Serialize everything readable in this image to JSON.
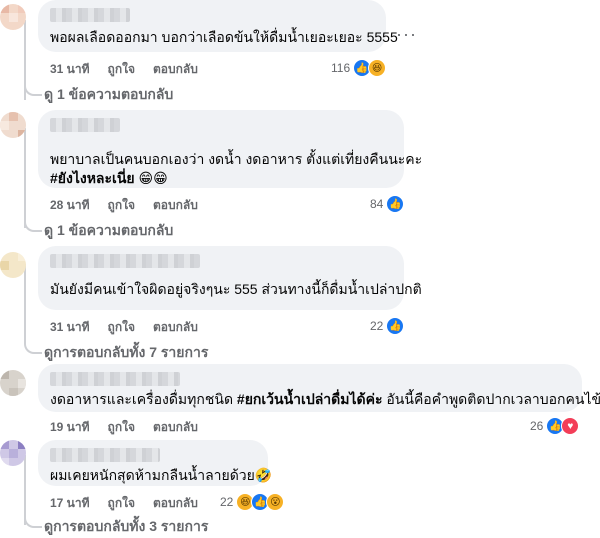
{
  "comments": [
    {
      "text": "พอผลเลือดออกมา บอกว่าเลือดข้นให้ดื่มน้ำเยอะเยอะ 5555",
      "time": "31 นาที",
      "like_label": "ถูกใจ",
      "reply_label": "ตอบกลับ",
      "reaction_count": "116",
      "reactions": [
        "like-icon",
        "haha-icon"
      ],
      "replies_link": "ดู 1 ข้อความตอบกลับ"
    },
    {
      "text_line1": "พยาบาลเป็นคนบอกเองว่า งดน้ำ งดอาหาร ตั้งแต่เที่ยงคืนนะคะ",
      "hashtag": "#ยังไงหละเนี่ย",
      "emoji": "😁😁",
      "time": "28 นาที",
      "like_label": "ถูกใจ",
      "reply_label": "ตอบกลับ",
      "reaction_count": "84",
      "reactions": [
        "like-icon"
      ],
      "replies_link": "ดู 1 ข้อความตอบกลับ"
    },
    {
      "text": "มันยังมีคนเข้าใจผิดอยู่จริงๆนะ 555 ส่วนทางนี้ก็ดื่มน้ำเปล่าปกติ",
      "time": "31 นาที",
      "like_label": "ถูกใจ",
      "reply_label": "ตอบกลับ",
      "reaction_count": "22",
      "reactions": [
        "like-icon"
      ],
      "replies_link": "ดูการตอบกลับทั้ง 7 รายการ"
    },
    {
      "text_pre": "งดอาหารและเครื่องดื่มทุกชนิด ",
      "hashtag": "#ยกเว้นน้ำเปล่าดื่มได้ค่ะ",
      "text_post": " อันนี้คือคำพูดติดปากเวลาบอกคนไข้",
      "time": "19 นาที",
      "like_label": "ถูกใจ",
      "reply_label": "ตอบกลับ",
      "reaction_count": "26",
      "reactions": [
        "like-icon",
        "love-icon"
      ]
    },
    {
      "text": "ผมเคยหนักสุดห้ามกลืนน้ำลายด้วย",
      "emoji": "🤣",
      "time": "17 นาที",
      "like_label": "ถูกใจ",
      "reply_label": "ตอบกลับ",
      "reaction_count": "22",
      "reactions": [
        "haha-icon",
        "like-icon",
        "wow-icon"
      ],
      "replies_link": "ดูการตอบกลับทั้ง 3 รายการ"
    }
  ],
  "more_options": "···"
}
